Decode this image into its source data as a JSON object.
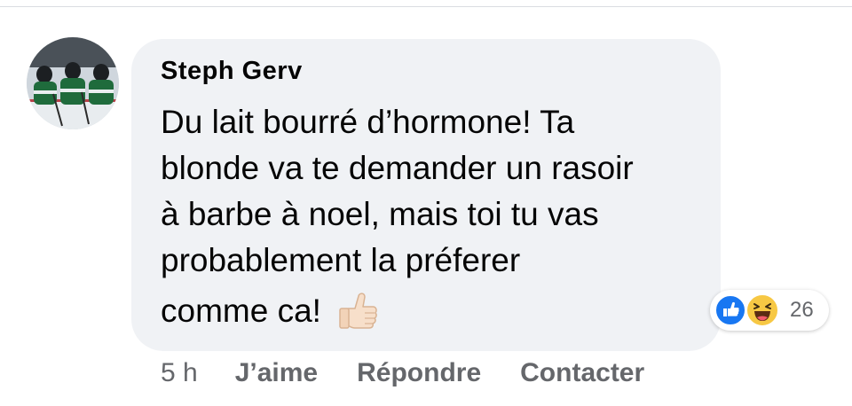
{
  "comment": {
    "author": "Steph Gerv",
    "text_lines": [
      "Du lait bourré d’hormone! Ta",
      "blonde va te demander un rasoir",
      "à barbe à noel, mais toi tu vas",
      "probablement la préferer"
    ],
    "text_last_line": "comme ca!",
    "emoji": "thumbs-up-light-skin-tone"
  },
  "reactions": {
    "types": [
      "like-icon",
      "haha-icon"
    ],
    "count": "26"
  },
  "actions": {
    "time": "5 h",
    "like_label": "J’aime",
    "reply_label": "Répondre",
    "contact_label": "Contacter"
  },
  "colors": {
    "bubble": "#f0f2f5",
    "text": "#050505",
    "secondary_text": "#65676b",
    "like_blue": "#1877f2",
    "haha_yellow": "#f7c844"
  }
}
